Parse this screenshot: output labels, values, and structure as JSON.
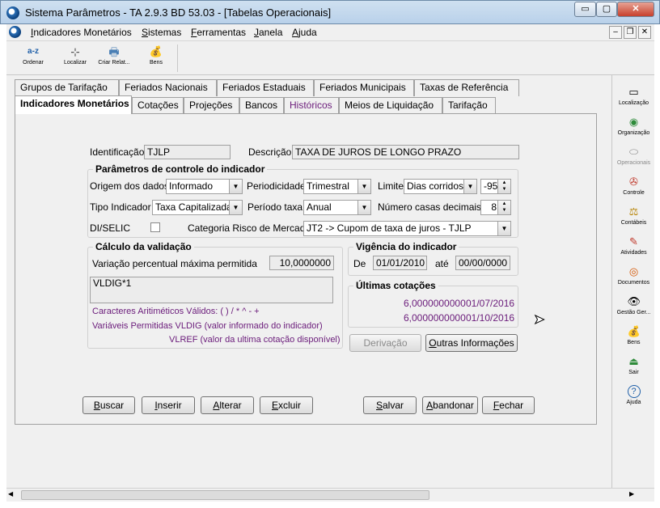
{
  "window": {
    "title": "Sistema Parâmetros -  TA 2.9.3 BD 53.03 - [Tabelas Operacionais]",
    "min": "▭",
    "max": "▢",
    "close": "✕"
  },
  "menu": {
    "items": [
      {
        "key": "I",
        "rest": "ndicadores Monetários"
      },
      {
        "key": "S",
        "rest": "istemas"
      },
      {
        "key": "F",
        "rest": "erramentas"
      },
      {
        "key": "J",
        "rest": "anela"
      },
      {
        "key": "A",
        "rest": "juda"
      }
    ],
    "mdi_min": "–",
    "mdi_restore": "❐",
    "mdi_close": "✕"
  },
  "toolbar": {
    "items": [
      {
        "label": "Ordenar",
        "icon": "a-z"
      },
      {
        "label": "Localizar",
        "icon": "⊹"
      },
      {
        "label": "Criar Relat...",
        "icon": "🖶"
      },
      {
        "label": "Bens",
        "icon": "💰"
      }
    ]
  },
  "tabs": {
    "row1": [
      "Grupos de Tarifação",
      "Feriados Nacionais",
      "Feriados Estaduais",
      "Feriados Municipais",
      "Taxas de Referência"
    ],
    "row2": [
      "Indicadores Monetários",
      "Cotações",
      "Projeções",
      "Bancos",
      "Históricos",
      "Meios de Liquidação",
      "Tarifação"
    ]
  },
  "form": {
    "identificacao_label": "Identificação",
    "identificacao": "TJLP",
    "descricao_label": "Descrição",
    "descricao": "TAXA DE JUROS DE LONGO PRAZO",
    "params_title": "Parâmetros de controle do indicador",
    "origem_label": "Origem dos dados",
    "origem": "Informado",
    "periodicidade_label": "Periodicidade",
    "periodicidade": "Trimestral",
    "limite_label": "Limite",
    "limite": "Dias corridos",
    "limite_num": "-95",
    "tipo_label": "Tipo Indicador",
    "tipo": "Taxa Capitalizada",
    "periodo_label": "Período taxa",
    "periodo": "Anual",
    "casas_label": "Número casas decimais",
    "casas": "8",
    "diselic_label": "DI/SELIC",
    "categoria_label": "Categoria Risco de Mercado",
    "categoria": "JT2 -> Cupom de taxa de juros - TJLP",
    "calc_title": "Cálculo da validação",
    "variacao_label": "Variação percentual máxima permitida",
    "variacao": "10,0000000",
    "formula": "VLDIG*1",
    "caracteres": "Caracteres Aritiméticos Válidos:      ( ) / * ^ - +",
    "variaveis": "Variáveis Permitidas VLDIG  (valor informado do indicador)",
    "vlref": "VLREF  (valor da ultima cotação disponível)",
    "vigencia_title": "Vigência do indicador",
    "de_label": "De",
    "de": "01/01/2010",
    "ate_label": "até",
    "ate": "00/00/0000",
    "ultimas_title": "Últimas cotações",
    "cotacoes": [
      {
        "valor": "6,0000000000",
        "data": "01/07/2016"
      },
      {
        "valor": "6,0000000000",
        "data": "01/10/2016"
      }
    ],
    "derivacao": "Derivação",
    "outras_key": "O",
    "outras_rest": "utras Informações"
  },
  "buttons": [
    {
      "key": "B",
      "rest": "uscar"
    },
    {
      "key": "I",
      "rest": "nserir"
    },
    {
      "key": "A",
      "rest": "lterar"
    },
    {
      "key": "E",
      "rest": "xcluir"
    },
    {
      "key": "S",
      "rest": "alvar"
    },
    {
      "key": "A",
      "rest": "bandonar"
    },
    {
      "key": "F",
      "rest": "echar"
    }
  ],
  "sidebar": {
    "items": [
      {
        "label": "Localização",
        "icon": "▭",
        "color": "#333"
      },
      {
        "label": "Organização",
        "icon": "◉",
        "color": "#2e8b3a"
      },
      {
        "label": "Operacionais",
        "icon": "⬭",
        "color": "#888"
      },
      {
        "label": "Controle",
        "icon": "✇",
        "color": "#c0392b"
      },
      {
        "label": "Contábeis",
        "icon": "⚖",
        "color": "#b8860b"
      },
      {
        "label": "Atividades",
        "icon": "✎",
        "color": "#c0392b"
      },
      {
        "label": "Documentos",
        "icon": "◎",
        "color": "#d35400"
      },
      {
        "label": "Gestão Ger...",
        "icon": "👁",
        "color": "#333"
      },
      {
        "label": "Bens",
        "icon": "💰",
        "color": "#2e8b3a"
      },
      {
        "label": "Sair",
        "icon": "⏏",
        "color": "#2e8b3a"
      },
      {
        "label": "Ajuda",
        "icon": "?",
        "color": "#1f5fa8"
      }
    ]
  }
}
